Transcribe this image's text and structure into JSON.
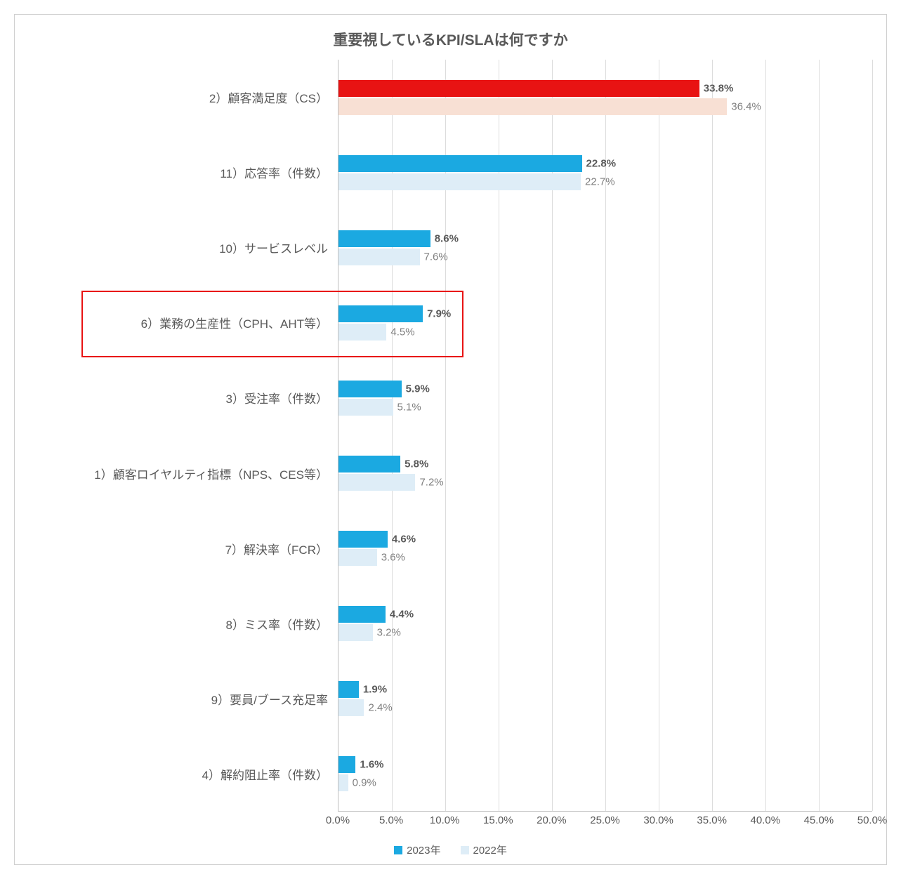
{
  "chart_data": {
    "type": "bar",
    "orientation": "horizontal",
    "title": "重要視しているKPI/SLAは何ですか",
    "xlabel": "",
    "ylabel": "",
    "xlim": [
      0,
      50
    ],
    "xticks": [
      0,
      5,
      10,
      15,
      20,
      25,
      30,
      35,
      40,
      45,
      50
    ],
    "xtick_labels": [
      "0.0%",
      "5.0%",
      "10.0%",
      "15.0%",
      "20.0%",
      "25.0%",
      "30.0%",
      "35.0%",
      "40.0%",
      "45.0%",
      "50.0%"
    ],
    "categories": [
      "2）顧客満足度（CS）",
      "11）応答率（件数）",
      "10）サービスレベル",
      "6）業務の生産性（CPH、AHT等）",
      "3）受注率（件数）",
      "1）顧客ロイヤルティ指標（NPS、CES等）",
      "7）解決率（FCR）",
      "8）ミス率（件数）",
      "9）要員/ブース充足率",
      "4）解約阻止率（件数）"
    ],
    "series": [
      {
        "name": "2023年",
        "values": [
          33.8,
          22.8,
          8.6,
          7.9,
          5.9,
          5.8,
          4.6,
          4.4,
          1.9,
          1.6
        ],
        "value_labels": [
          "33.8%",
          "22.8%",
          "8.6%",
          "7.9%",
          "5.9%",
          "5.8%",
          "4.6%",
          "4.4%",
          "1.9%",
          "1.6%"
        ]
      },
      {
        "name": "2022年",
        "values": [
          36.4,
          22.7,
          7.6,
          4.5,
          5.1,
          7.2,
          3.6,
          3.2,
          2.4,
          0.9
        ],
        "value_labels": [
          "36.4%",
          "22.7%",
          "7.6%",
          "4.5%",
          "5.1%",
          "7.2%",
          "3.6%",
          "3.2%",
          "2.4%",
          "0.9%"
        ]
      }
    ],
    "legend": {
      "position": "bottom",
      "items": [
        "2023年",
        "2022年"
      ]
    },
    "first_bar_red": true,
    "highlighted_category_index": 3
  }
}
